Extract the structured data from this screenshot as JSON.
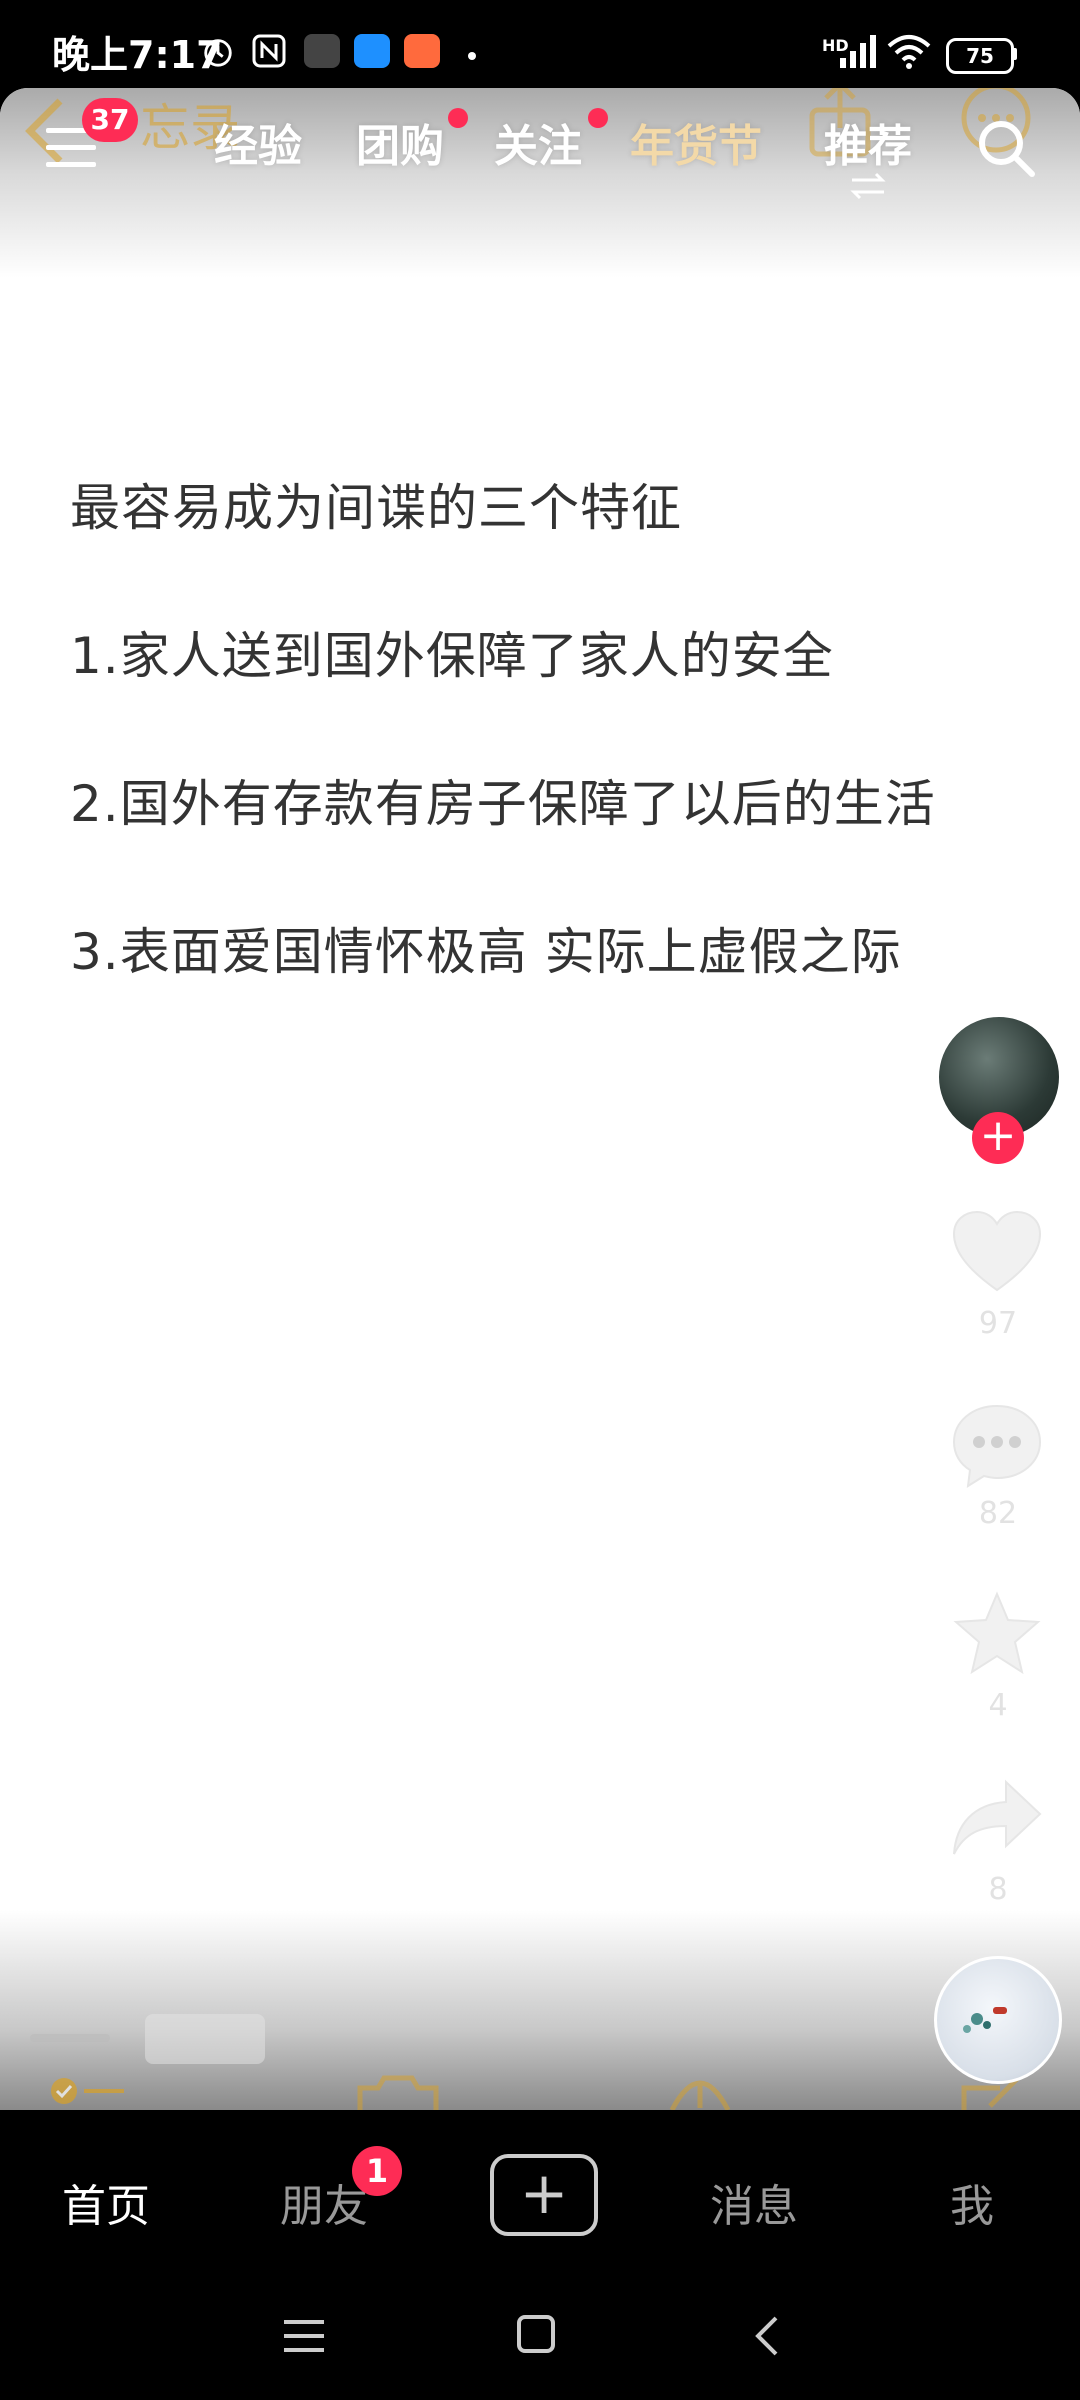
{
  "status_bar": {
    "time": "晚上7:17",
    "network": "HD",
    "battery": "75"
  },
  "background_memo": {
    "title": "忘录",
    "badge": "37"
  },
  "top_tabs": {
    "items": [
      {
        "label": "经验",
        "dot": false
      },
      {
        "label": "团购",
        "dot": true
      },
      {
        "label": "关注",
        "dot": true
      },
      {
        "label": "年货节",
        "dot": false
      },
      {
        "label": "推荐",
        "dot": false
      }
    ],
    "active": "推荐"
  },
  "note": {
    "lines": [
      "最容易成为间谍的三个特征",
      "1.家人送到国外保障了家人的安全",
      "2.国外有存款有房子保障了以后的生活",
      "3.表面爱国情怀极高 实际上虚假之际"
    ]
  },
  "actions": {
    "likes": "97",
    "comments": "82",
    "favorites": "4",
    "shares": "8"
  },
  "bottom_nav": {
    "home": "首页",
    "friends": "朋友",
    "friends_badge": "1",
    "messages": "消息",
    "me": "我"
  },
  "colors": {
    "accent": "#fe2c55",
    "tab_special": "#f3d9a8",
    "memo_gold": "#d9a126"
  }
}
